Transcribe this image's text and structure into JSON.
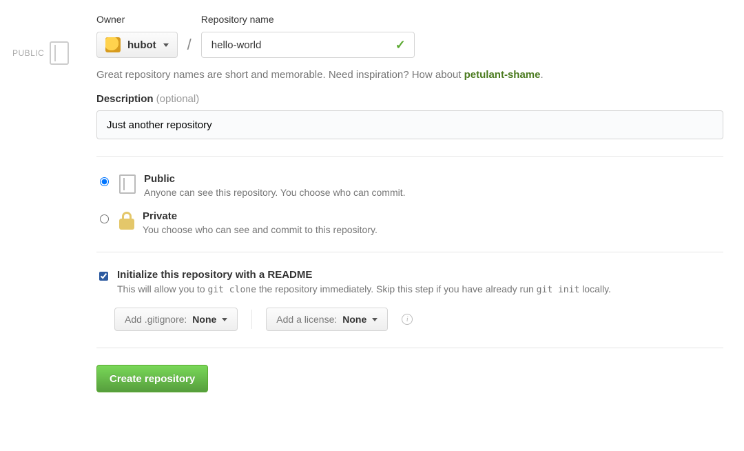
{
  "sidebar": {
    "label": "PUBLIC"
  },
  "fields": {
    "owner_label": "Owner",
    "repo_label": "Repository name",
    "owner_name": "hubot",
    "repo_name": "hello-world"
  },
  "hint": {
    "prefix": "Great repository names are short and memorable. Need inspiration? How about ",
    "suggestion": "petulant-shame",
    "suffix": "."
  },
  "description": {
    "label_main": "Description",
    "label_optional": " (optional)",
    "value": "Just another repository"
  },
  "visibility": {
    "public": {
      "title": "Public",
      "desc": "Anyone can see this repository. You choose who can commit.",
      "selected": true
    },
    "private": {
      "title": "Private",
      "desc": "You choose who can see and commit to this repository.",
      "selected": false
    }
  },
  "init": {
    "checked": true,
    "title": "Initialize this repository with a README",
    "desc_before": "This will allow you to ",
    "code1": "git clone",
    "desc_mid": " the repository immediately. Skip this step if you have already run ",
    "code2": "git init",
    "desc_after": " locally."
  },
  "dropdowns": {
    "gitignore_prefix": "Add .gitignore: ",
    "gitignore_value": "None",
    "license_prefix": "Add a license: ",
    "license_value": "None"
  },
  "submit": {
    "label": "Create repository"
  }
}
